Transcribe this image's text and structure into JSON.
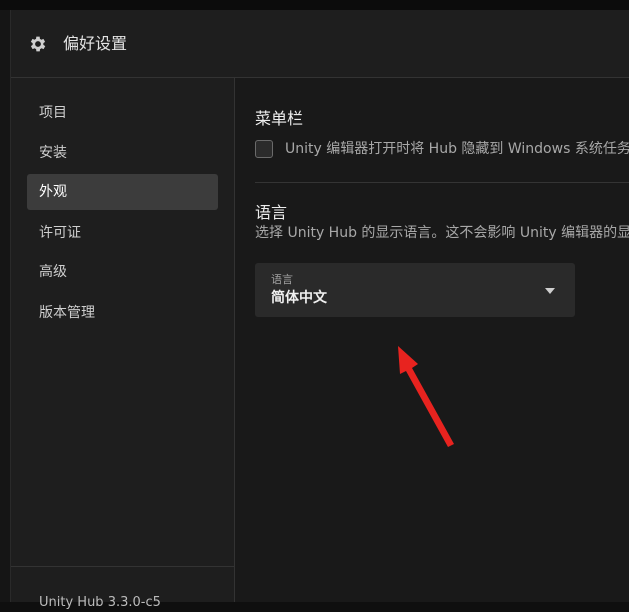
{
  "dialog": {
    "title": "偏好设置",
    "header_icon": "gear-icon"
  },
  "sidebar": {
    "items": [
      {
        "label": "项目",
        "active": false
      },
      {
        "label": "安装",
        "active": false
      },
      {
        "label": "外观",
        "active": true
      },
      {
        "label": "许可证",
        "active": false
      },
      {
        "label": "高级",
        "active": false
      },
      {
        "label": "版本管理",
        "active": false
      }
    ],
    "footer_version": "Unity Hub 3.3.0-c5"
  },
  "content": {
    "menubar": {
      "title": "菜单栏",
      "checkbox_label": "Unity 编辑器打开时将 Hub 隐藏到 Windows 系统任务栏",
      "checked": false
    },
    "language": {
      "title": "语言",
      "description": "选择 Unity Hub 的显示语言。这不会影响 Unity 编辑器的显示语言。",
      "select_label": "语言",
      "select_value": "简体中文"
    }
  },
  "colors": {
    "dialog_bg": "#1e1e1e",
    "content_bg": "#191919",
    "active_item_bg": "#3c3c3c",
    "select_bg": "#2a2a2a",
    "annotation_arrow": "#e8231f"
  }
}
